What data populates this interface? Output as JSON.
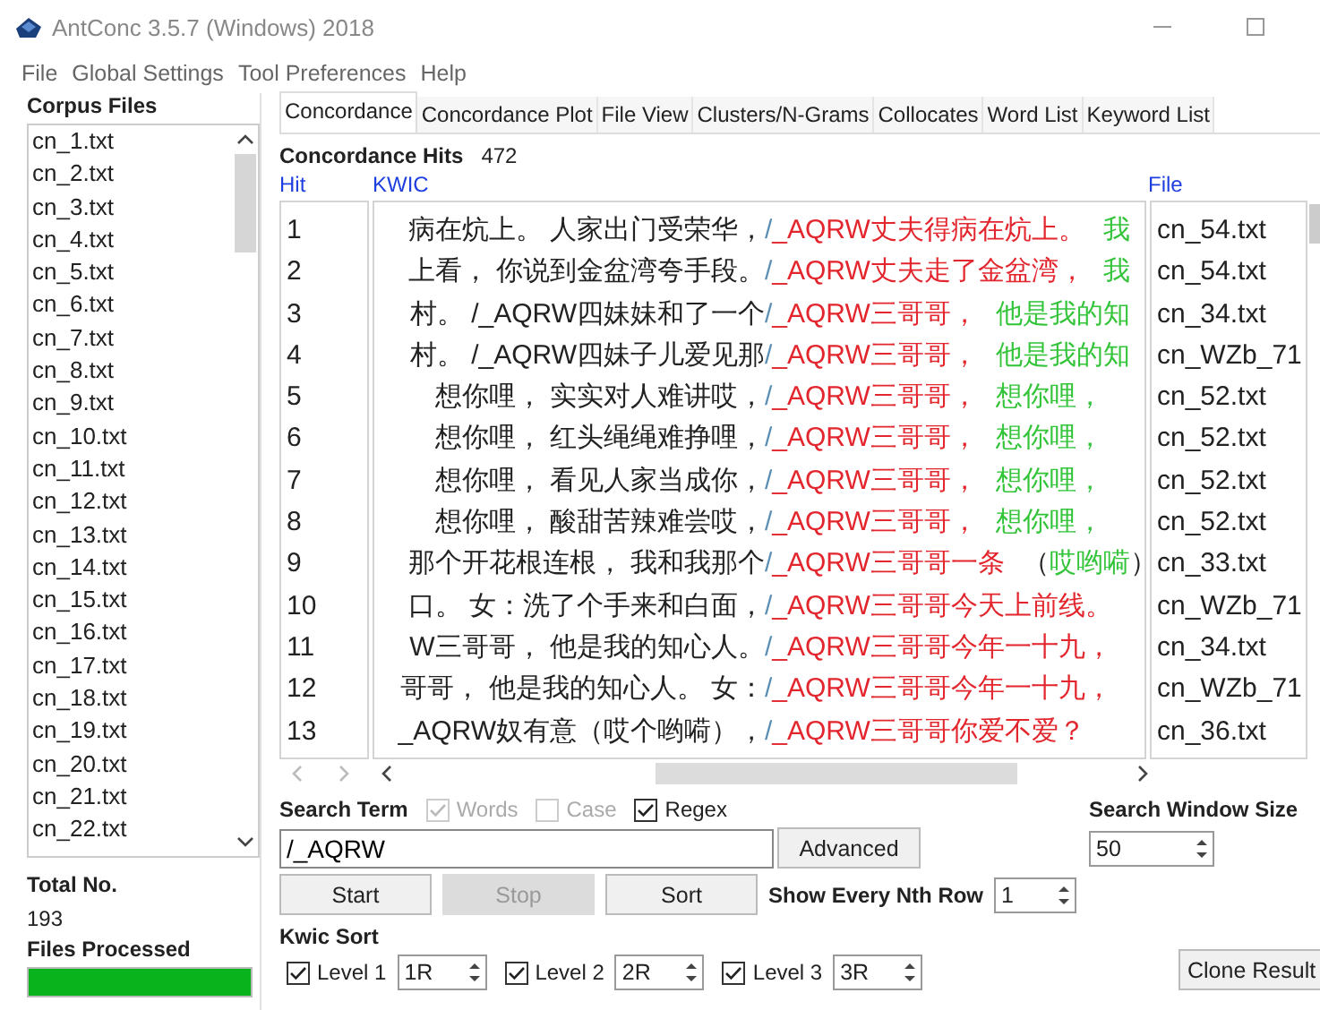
{
  "window": {
    "title": "AntConc 3.5.7 (Windows) 2018"
  },
  "menu": [
    "File",
    "Global Settings",
    "Tool Preferences",
    "Help"
  ],
  "corpus": {
    "title": "Corpus Files",
    "files": [
      "cn_1.txt",
      "cn_2.txt",
      "cn_3.txt",
      "cn_4.txt",
      "cn_5.txt",
      "cn_6.txt",
      "cn_7.txt",
      "cn_8.txt",
      "cn_9.txt",
      "cn_10.txt",
      "cn_11.txt",
      "cn_12.txt",
      "cn_13.txt",
      "cn_14.txt",
      "cn_15.txt",
      "cn_16.txt",
      "cn_17.txt",
      "cn_18.txt",
      "cn_19.txt",
      "cn_20.txt",
      "cn_21.txt",
      "cn_22.txt"
    ],
    "total_label": "Total No.",
    "total": "193",
    "progress_label": "Files Processed",
    "level": 1
  },
  "tabs": [
    {
      "label": "Concordance",
      "selected": true
    },
    {
      "label": "Concordance Plot",
      "selected": false
    },
    {
      "label": "File View",
      "selected": false
    },
    {
      "label": "Clusters/N-Grams",
      "selected": false
    },
    {
      "label": "Collocates",
      "selected": false
    },
    {
      "label": "Word List",
      "selected": false
    },
    {
      "label": "Keyword List",
      "selected": false
    }
  ],
  "hits": {
    "label": "Concordance Hits",
    "count": "472"
  },
  "table": {
    "columns": [
      "Hit",
      "KWIC",
      "File"
    ],
    "rows": [
      {
        "hit": "1",
        "left": "病在炕上。 人家出门受荣华，",
        "node": [
          {
            "text": "/",
            "color": "#5b8fb5"
          },
          {
            "text": "_AQRW丈夫得病在炕上。",
            "color": "#e3262d"
          }
        ],
        "right": [
          {
            "text": "我",
            "color": "#33c43a"
          }
        ],
        "file": "cn_54.txt"
      },
      {
        "hit": "2",
        "left": "上看， 你说到金盆湾夸手段。",
        "node": [
          {
            "text": "/",
            "color": "#5b8fb5"
          },
          {
            "text": "_AQRW丈夫走了金盆湾，",
            "color": "#e3262d"
          }
        ],
        "right": [
          {
            "text": "我",
            "color": "#33c43a"
          }
        ],
        "file": "cn_54.txt"
      },
      {
        "hit": "3",
        "left": "村。 /_AQRW四妹妹和了一个",
        "node": [
          {
            "text": "/",
            "color": "#5b8fb5"
          },
          {
            "text": "_AQRW三哥哥，",
            "color": "#e3262d"
          }
        ],
        "right": [
          {
            "text": "他是我的知",
            "color": "#33c43a"
          }
        ],
        "file": "cn_34.txt"
      },
      {
        "hit": "4",
        "left": "村。 /_AQRW四妹子儿爱见那",
        "node": [
          {
            "text": "/",
            "color": "#5b8fb5"
          },
          {
            "text": "_AQRW三哥哥，",
            "color": "#e3262d"
          }
        ],
        "right": [
          {
            "text": "他是我的知",
            "color": "#33c43a"
          }
        ],
        "file": "cn_WZb_71"
      },
      {
        "hit": "5",
        "left": "想你哩， 实实对人难讲哎，",
        "node": [
          {
            "text": "/",
            "color": "#5b8fb5"
          },
          {
            "text": "_AQRW三哥哥，",
            "color": "#e3262d"
          }
        ],
        "right": [
          {
            "text": "想你哩，",
            "color": "#33c43a"
          }
        ],
        "file": "cn_52.txt"
      },
      {
        "hit": "6",
        "left": "想你哩， 红头绳绳难挣哩，",
        "node": [
          {
            "text": "/",
            "color": "#5b8fb5"
          },
          {
            "text": "_AQRW三哥哥，",
            "color": "#e3262d"
          }
        ],
        "right": [
          {
            "text": "想你哩，",
            "color": "#33c43a"
          }
        ],
        "file": "cn_52.txt"
      },
      {
        "hit": "7",
        "left": "想你哩， 看见人家当成你，",
        "node": [
          {
            "text": "/",
            "color": "#5b8fb5"
          },
          {
            "text": "_AQRW三哥哥，",
            "color": "#e3262d"
          }
        ],
        "right": [
          {
            "text": "想你哩，",
            "color": "#33c43a"
          }
        ],
        "file": "cn_52.txt"
      },
      {
        "hit": "8",
        "left": "想你哩， 酸甜苦辣难尝哎，",
        "node": [
          {
            "text": "/",
            "color": "#5b8fb5"
          },
          {
            "text": "_AQRW三哥哥，",
            "color": "#e3262d"
          }
        ],
        "right": [
          {
            "text": "想你哩，",
            "color": "#33c43a"
          }
        ],
        "file": "cn_52.txt"
      },
      {
        "hit": "9",
        "left": "那个开花根连根， 我和我那个",
        "node": [
          {
            "text": "/",
            "color": "#5b8fb5"
          },
          {
            "text": "_AQRW三哥哥一条",
            "color": "#e3262d"
          }
        ],
        "right": [
          {
            "text": "（",
            "color": "#222222"
          },
          {
            "text": "哎哟嗬",
            "color": "#33c43a"
          },
          {
            "text": "）",
            "color": "#222222"
          }
        ],
        "file": "cn_33.txt"
      },
      {
        "hit": "10",
        "left": "口。 女：洗了个手来和白面，",
        "node": [
          {
            "text": "/",
            "color": "#5b8fb5"
          },
          {
            "text": "_AQRW三哥哥今天上前线。",
            "color": "#e3262d"
          }
        ],
        "right": [],
        "file": "cn_WZb_71"
      },
      {
        "hit": "11",
        "left": "W三哥哥， 他是我的知心人。",
        "node": [
          {
            "text": "/",
            "color": "#5b8fb5"
          },
          {
            "text": "_AQRW三哥哥今年一十九，",
            "color": "#e3262d"
          }
        ],
        "right": [],
        "file": "cn_34.txt"
      },
      {
        "hit": "12",
        "left": "哥哥， 他是我的知心人。 女：",
        "node": [
          {
            "text": "/",
            "color": "#5b8fb5"
          },
          {
            "text": "_AQRW三哥哥今年一十九，",
            "color": "#e3262d"
          }
        ],
        "right": [],
        "file": "cn_WZb_71"
      },
      {
        "hit": "13",
        "left": "_AQRW奴有意（哎个哟嗬），",
        "node": [
          {
            "text": "/",
            "color": "#5b8fb5"
          },
          {
            "text": "_AQRW三哥哥你爱不爱？",
            "color": "#e3262d"
          }
        ],
        "right": [],
        "file": "cn_36.txt"
      }
    ]
  },
  "search": {
    "label": "Search Term",
    "options": [
      {
        "label": "Words",
        "checked": true,
        "disabled": true
      },
      {
        "label": "Case",
        "checked": false,
        "disabled": true
      },
      {
        "label": "Regex",
        "checked": true,
        "disabled": false
      }
    ],
    "value": "/_AQRW",
    "advanced": "Advanced"
  },
  "buttons": [
    {
      "label": "Start",
      "disabled": false
    },
    {
      "label": "Stop",
      "disabled": true
    },
    {
      "label": "Sort",
      "disabled": false
    }
  ],
  "nth": {
    "label": "Show Every Nth Row",
    "value": "1"
  },
  "window_size": {
    "label": "Search Window Size",
    "value": "50"
  },
  "kwic_sort": {
    "label": "Kwic Sort",
    "levels": [
      {
        "label": "Level 1",
        "checked": true,
        "value": "1R"
      },
      {
        "label": "Level 2",
        "checked": true,
        "value": "2R"
      },
      {
        "label": "Level 3",
        "checked": true,
        "value": "3R"
      }
    ]
  },
  "clone": "Clone Result"
}
